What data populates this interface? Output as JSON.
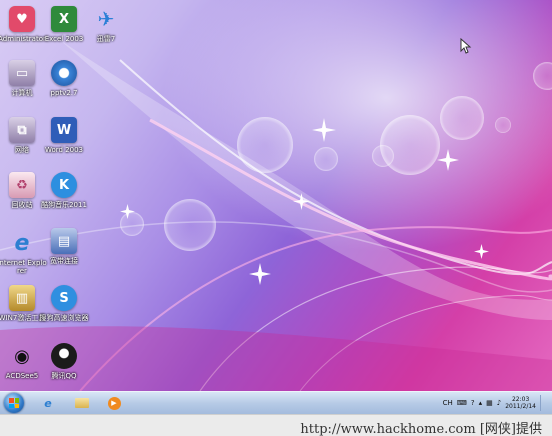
{
  "desktop": {
    "icons": [
      {
        "label": "Administrator",
        "icon": "user-folder-icon",
        "color": "#e24a6a"
      },
      {
        "label": "Excel 2003",
        "icon": "excel-icon",
        "color": "#2f8a3b"
      },
      {
        "label": "迅雷7",
        "icon": "thunder-bird-icon",
        "color": "#2a7fd6"
      },
      {
        "label": "计算机",
        "icon": "computer-icon",
        "color": "#b8a6c9"
      },
      {
        "label": "pptv2.7",
        "icon": "pptv-icon",
        "color": "#3a84d8"
      },
      {
        "label": "网络",
        "icon": "network-icon",
        "color": "#b8a6c9"
      },
      {
        "label": "Word 2003",
        "icon": "word-icon",
        "color": "#2f5db8"
      },
      {
        "label": "回收站",
        "icon": "recycle-bin-icon",
        "color": "#f3d6e2"
      },
      {
        "label": "酷狗音乐2011",
        "icon": "kugou-icon",
        "color": "#2d8fe0"
      },
      {
        "label": "Internet Explorer",
        "icon": "internet-explorer-icon",
        "color": "#2d7fd1"
      },
      {
        "label": "宽带连接",
        "icon": "broadband-connection-icon",
        "color": "#4a6fb8"
      },
      {
        "label": "WIN7激活工具",
        "icon": "activation-tool-icon",
        "color": "#c9a441"
      },
      {
        "label": "搜狗高速浏览器",
        "icon": "sogou-browser-icon",
        "color": "#2f8fe0"
      },
      {
        "label": "ACDSee5",
        "icon": "acdsee-eye-icon",
        "color": "#222222"
      },
      {
        "label": "腾讯QQ",
        "icon": "qq-penguin-icon",
        "color": "#1b1b1b"
      }
    ]
  },
  "taskbar": {
    "pinned": [
      {
        "name": "internet-explorer",
        "icon": "internet-explorer-icon"
      },
      {
        "name": "file-explorer",
        "icon": "folder-icon"
      },
      {
        "name": "media-player",
        "icon": "media-player-icon"
      }
    ],
    "tray": {
      "language": "CH",
      "time": "22:03",
      "date": "2011/2/14"
    }
  },
  "watermark": "http://www.hackhome.com [网侠]提供"
}
